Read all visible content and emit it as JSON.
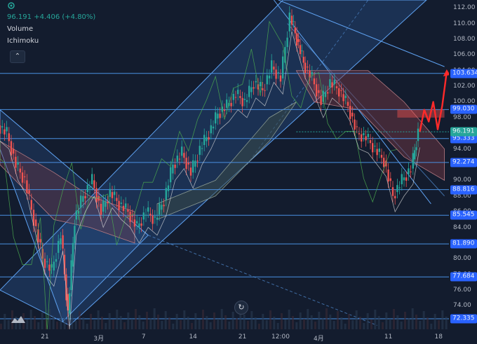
{
  "legend": {
    "price": "96.191",
    "change": "+4.406 (+4.80%)",
    "indicators": [
      "Volume",
      "Ichimoku"
    ]
  },
  "icons": {
    "collapse": "chevron-up-icon",
    "reset": "reset-icon",
    "logo": "tradingview-logo-icon",
    "top": "settings-icon"
  },
  "colors": {
    "background": "#131c2e",
    "up": "#26a69a",
    "down": "#ef5350",
    "horizontal_line": "#4a90e2",
    "channel_fill": "#3d7fd9",
    "forecast": "#ff2a2a",
    "cloud_bear": "#7a3a44",
    "cloud_bull": "#3a4a44"
  },
  "chart_data": {
    "type": "line",
    "price_axis_ticks": [
      112.0,
      110.0,
      108.0,
      106.0,
      104.0,
      102.0,
      100.0,
      98.0,
      96.0,
      94.0,
      92.0,
      90.0,
      88.0,
      86.0,
      84.0,
      82.0,
      80.0,
      78.0,
      76.0,
      74.0,
      72.0
    ],
    "ylim": [
      71.0,
      113.0
    ],
    "time_axis_labels": [
      {
        "label": "21",
        "t": 0.1
      },
      {
        "label": "3月",
        "t": 0.22
      },
      {
        "label": "7",
        "t": 0.32
      },
      {
        "label": "14",
        "t": 0.43
      },
      {
        "label": "21",
        "t": 0.54
      },
      {
        "label": "12:00",
        "t": 0.625
      },
      {
        "label": "4月",
        "t": 0.71
      },
      {
        "label": "11",
        "t": 0.865
      },
      {
        "label": "18",
        "t": 0.977
      }
    ],
    "horizontal_levels": [
      103.634,
      99.03,
      95.333,
      92.274,
      88.816,
      85.545,
      81.89,
      77.684,
      72.335
    ],
    "level_badges": [
      "103.634",
      "99.030",
      "95.333",
      "92.274",
      "88.816",
      "85.545",
      "81.890",
      "77.684",
      "72.335"
    ],
    "last_price": 96.191,
    "last_price_label": "96.191",
    "price_series_x": [
      0.0,
      0.02,
      0.04,
      0.06,
      0.08,
      0.1,
      0.12,
      0.14,
      0.155,
      0.17,
      0.19,
      0.21,
      0.23,
      0.25,
      0.27,
      0.29,
      0.31,
      0.33,
      0.35,
      0.37,
      0.39,
      0.41,
      0.43,
      0.45,
      0.47,
      0.49,
      0.51,
      0.53,
      0.55,
      0.57,
      0.59,
      0.61,
      0.63,
      0.65,
      0.665,
      0.68,
      0.7,
      0.72,
      0.74,
      0.76,
      0.78,
      0.8,
      0.82,
      0.84,
      0.86,
      0.88,
      0.9,
      0.92,
      0.935
    ],
    "price_series_y": [
      97.0,
      96.0,
      92.0,
      90.0,
      85.0,
      80.0,
      78.5,
      83.0,
      73.0,
      85.0,
      88.0,
      90.0,
      86.0,
      88.5,
      87.0,
      86.0,
      84.0,
      86.0,
      85.0,
      87.5,
      92.0,
      93.5,
      91.0,
      94.0,
      96.0,
      98.5,
      99.5,
      101.0,
      100.0,
      102.5,
      101.5,
      104.5,
      103.0,
      111.0,
      108.0,
      105.0,
      103.0,
      100.0,
      102.5,
      101.5,
      99.5,
      96.0,
      95.5,
      94.0,
      92.5,
      88.0,
      90.0,
      91.5,
      96.191
    ],
    "forecast_x": [
      0.935,
      0.945,
      0.955,
      0.965,
      0.975,
      0.985,
      0.995
    ],
    "forecast_y": [
      96.191,
      99.0,
      97.5,
      100.0,
      96.5,
      99.5,
      103.8
    ],
    "resistance_zone": [
      98.0,
      99.0
    ]
  }
}
